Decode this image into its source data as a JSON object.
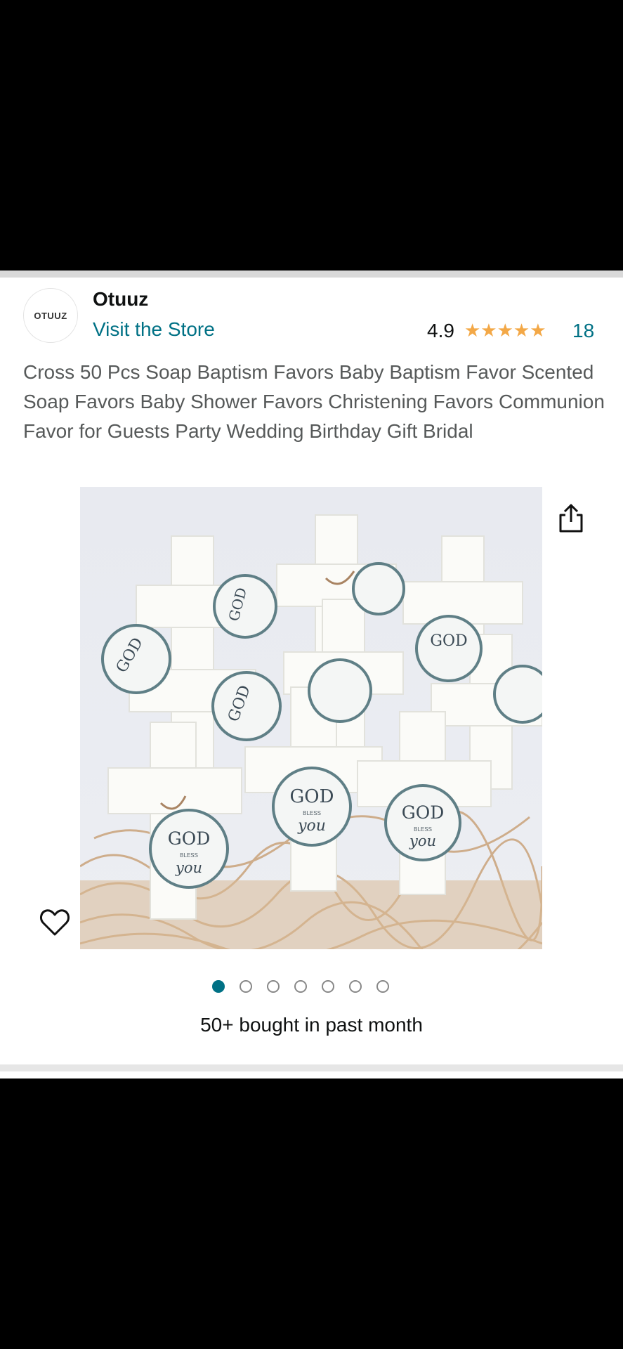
{
  "store": {
    "logo_text": "OTUUZ",
    "brand": "Otuuz",
    "visit_label": "Visit the Store"
  },
  "rating": {
    "value": "4.9",
    "stars": "★★★★★",
    "count": "18"
  },
  "product": {
    "title": "Cross 50 Pcs Soap Baptism Favors Baby Baptism Favor Scented Soap Favors Baby Shower Favors Christening Favors Communion Favor for Guests Party Wedding Birthday Gift Bridal",
    "image_tag_text": "GOD",
    "image_tag_small": "BLESS",
    "image_tag_script": "you",
    "carousel": {
      "count": 7,
      "active": 1
    },
    "bought": "50+ bought in past month"
  },
  "icons": {
    "share": "share-icon",
    "favorite": "heart-icon"
  },
  "colors": {
    "link": "#007185",
    "star": "#f3a847",
    "text": "#0f1111",
    "muted": "#565959"
  }
}
